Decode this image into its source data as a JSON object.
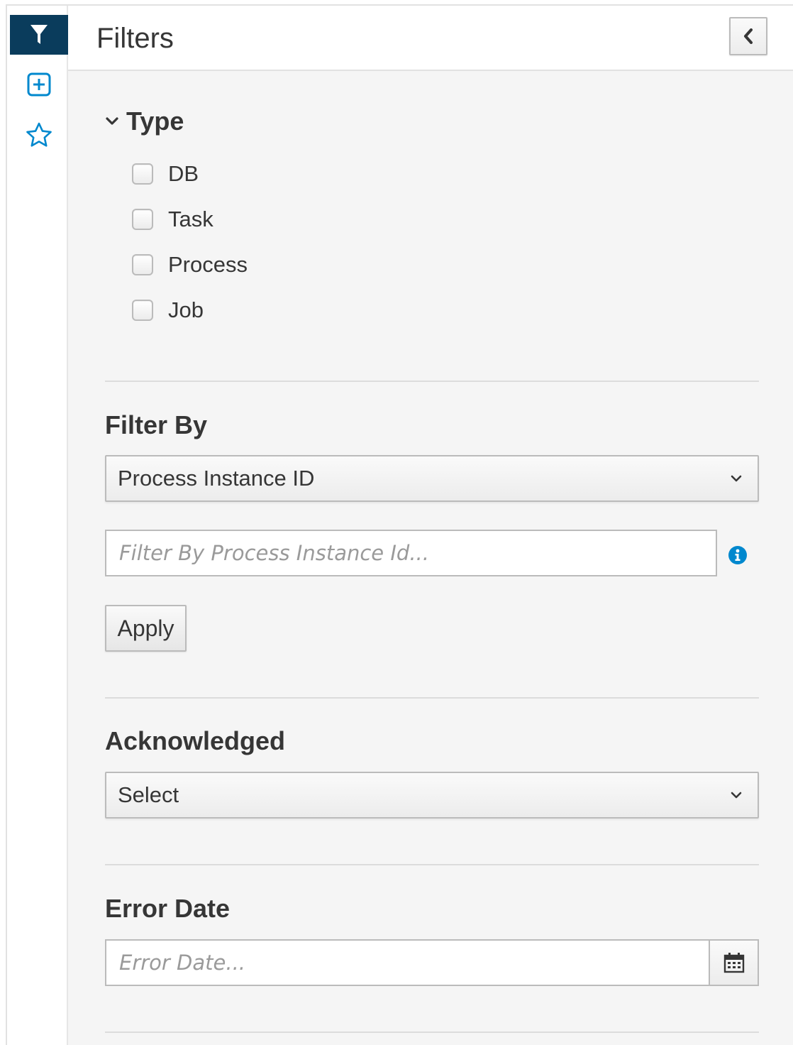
{
  "header": {
    "title": "Filters"
  },
  "rail": {
    "items": [
      {
        "name": "filter",
        "icon": "filter-icon",
        "active": true
      },
      {
        "name": "add",
        "icon": "plus-square-icon",
        "active": false
      },
      {
        "name": "favorites",
        "icon": "star-icon",
        "active": false
      }
    ]
  },
  "type_filter": {
    "label": "Type",
    "options": [
      "DB",
      "Task",
      "Process",
      "Job"
    ]
  },
  "filter_by": {
    "heading": "Filter By",
    "selected": "Process Instance ID",
    "input_placeholder": "Filter By Process Instance Id...",
    "apply_label": "Apply"
  },
  "acknowledged": {
    "heading": "Acknowledged",
    "selected": "Select"
  },
  "error_date": {
    "heading": "Error Date",
    "input_placeholder": "Error Date..."
  },
  "colors": {
    "accent": "#0a3c5c",
    "link_blue": "#0088ce",
    "panel_bg": "#f5f5f5"
  }
}
